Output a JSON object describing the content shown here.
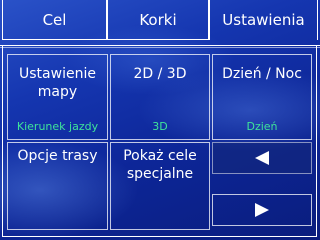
{
  "tabs": [
    {
      "label": "Cel"
    },
    {
      "label": "Korki"
    },
    {
      "label": "Ustawienia"
    }
  ],
  "buttons": {
    "map_settings": {
      "label": "Ustawienie mapy",
      "value": "Kierunek jazdy"
    },
    "view_mode": {
      "label": "2D / 3D",
      "value": "3D"
    },
    "day_night": {
      "label": "Dzień / Noc",
      "value": "Dzień"
    },
    "route_options": {
      "label": "Opcje trasy"
    },
    "show_pois": {
      "label": "Pokaż cele specjalne"
    },
    "prev_page": {
      "icon": "left-arrow-icon"
    },
    "next_page": {
      "icon": "right-arrow-icon"
    }
  },
  "colors": {
    "background": "#1536b0",
    "value_text": "#3fe39a",
    "border": "#ffffff"
  }
}
